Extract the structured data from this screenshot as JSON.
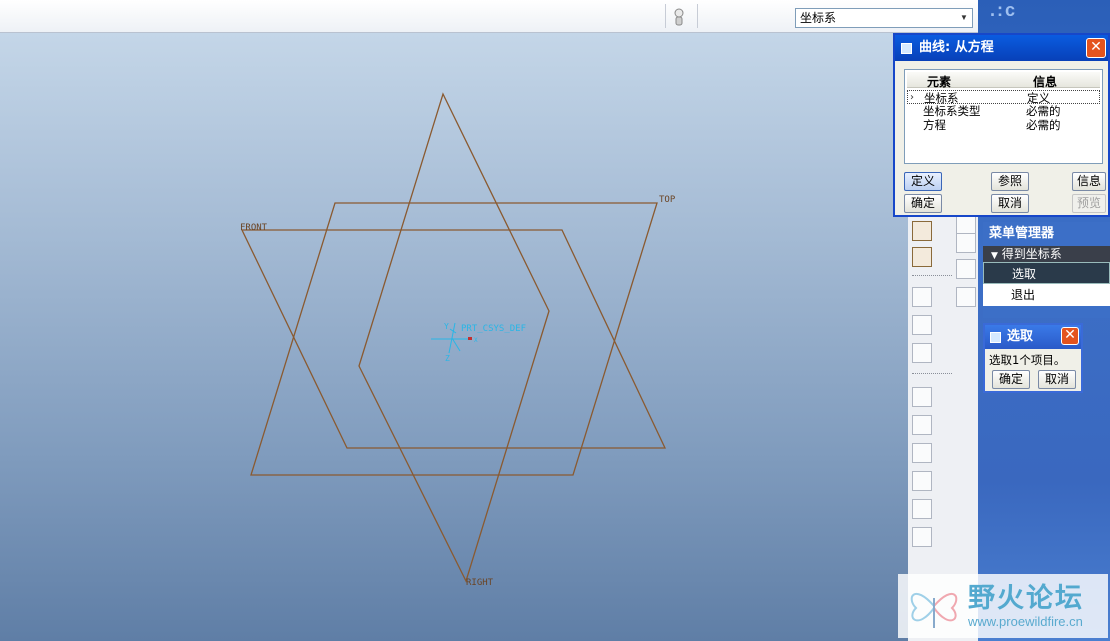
{
  "toolbar": {
    "filter_value": "坐标系"
  },
  "viewport": {
    "plane_labels": {
      "front": "FRONT",
      "top": "TOP",
      "right": "RIGHT"
    },
    "csys_label": "PRT_CSYS_DEF",
    "axis_labels": {
      "y": "Y",
      "x": "X",
      "z": "Z"
    }
  },
  "curve_dialog": {
    "title": "曲线: 从方程",
    "columns": {
      "element": "元素",
      "info": "信息"
    },
    "rows": [
      {
        "element": "坐标系",
        "info": "定义"
      },
      {
        "element": "坐标系类型",
        "info": "必需的"
      },
      {
        "element": "方程",
        "info": "必需的"
      }
    ],
    "buttons": {
      "define": "定义",
      "refs": "参照",
      "info": "信息",
      "ok": "确定",
      "cancel": "取消",
      "preview": "预览"
    }
  },
  "menu_manager": {
    "title": "菜单管理器",
    "submenu": "得到坐标系",
    "items": [
      "选取",
      "退出"
    ]
  },
  "select_dialog": {
    "title": "选取",
    "message": "选取1个项目。",
    "ok": "确定",
    "cancel": "取消"
  },
  "watermark": {
    "title": "野火论坛",
    "url": "www.proewildfire.cn"
  },
  "colors": {
    "datum_plane": "#8a5a30",
    "csys": "#29b6e6",
    "titlebar": "#0a50d0",
    "panel": "#3c6fc7"
  }
}
